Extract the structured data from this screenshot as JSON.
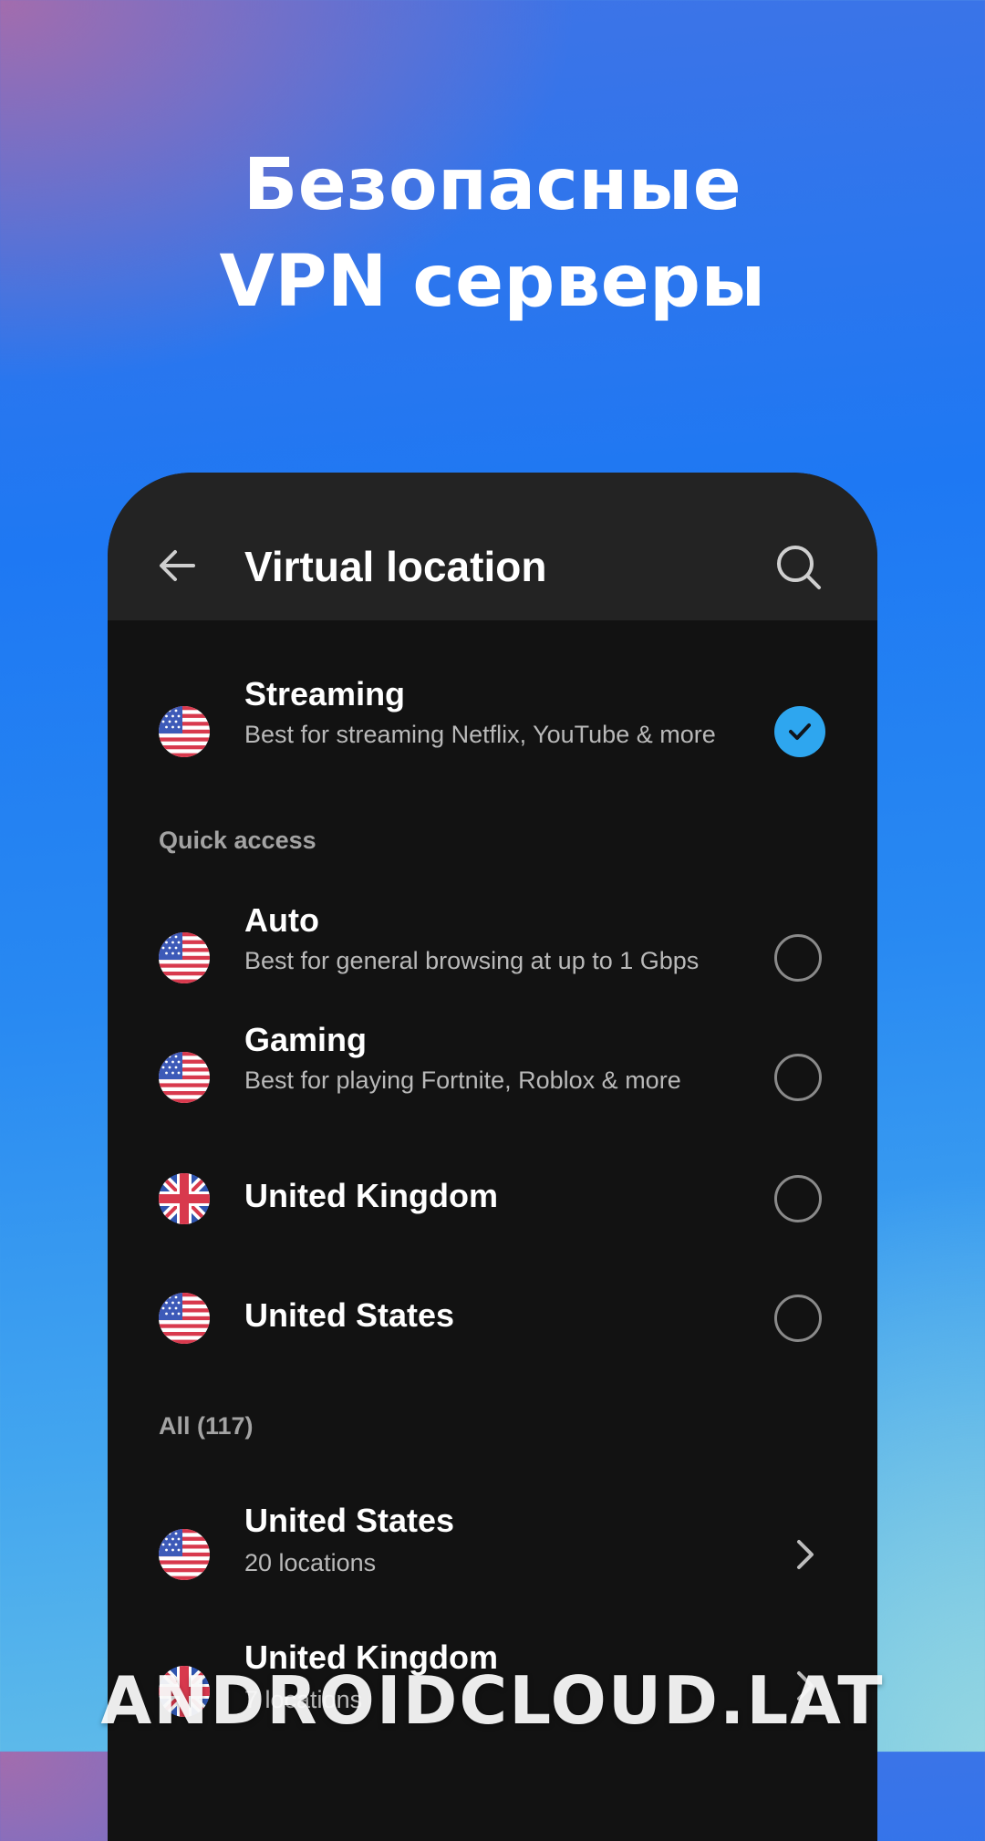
{
  "promo": {
    "headline_line1": "Безопасные",
    "headline_line2": "VPN серверы"
  },
  "appbar": {
    "back_icon": "arrow-left-icon",
    "title": "Virtual location",
    "search_icon": "search-icon"
  },
  "selected": {
    "flag": "us-flag-icon",
    "name": "Streaming",
    "subtitle": "Best for streaming Netflix, YouTube & more",
    "state": "checked"
  },
  "quick_access": {
    "header": "Quick access",
    "items": [
      {
        "flag": "us-flag-icon",
        "name": "Auto",
        "subtitle": "Best for general browsing at up to 1 Gbps"
      },
      {
        "flag": "us-flag-icon",
        "name": "Gaming",
        "subtitle": "Best for playing Fortnite, Roblox & more"
      },
      {
        "flag": "uk-flag-icon",
        "name": "United Kingdom"
      },
      {
        "flag": "us-flag-icon",
        "name": "United States"
      }
    ]
  },
  "all": {
    "header": "All (117)",
    "items": [
      {
        "flag": "us-flag-icon",
        "name": "United States",
        "subtitle": "20 locations"
      },
      {
        "flag": "uk-flag-icon",
        "name": "United Kingdom",
        "subtitle": "7 locations"
      }
    ]
  },
  "watermark": "ANDROIDCLOUD.LAT",
  "colors": {
    "accent": "#2ea6ef",
    "list_bg": "#121212",
    "appbar_bg": "#232323"
  }
}
